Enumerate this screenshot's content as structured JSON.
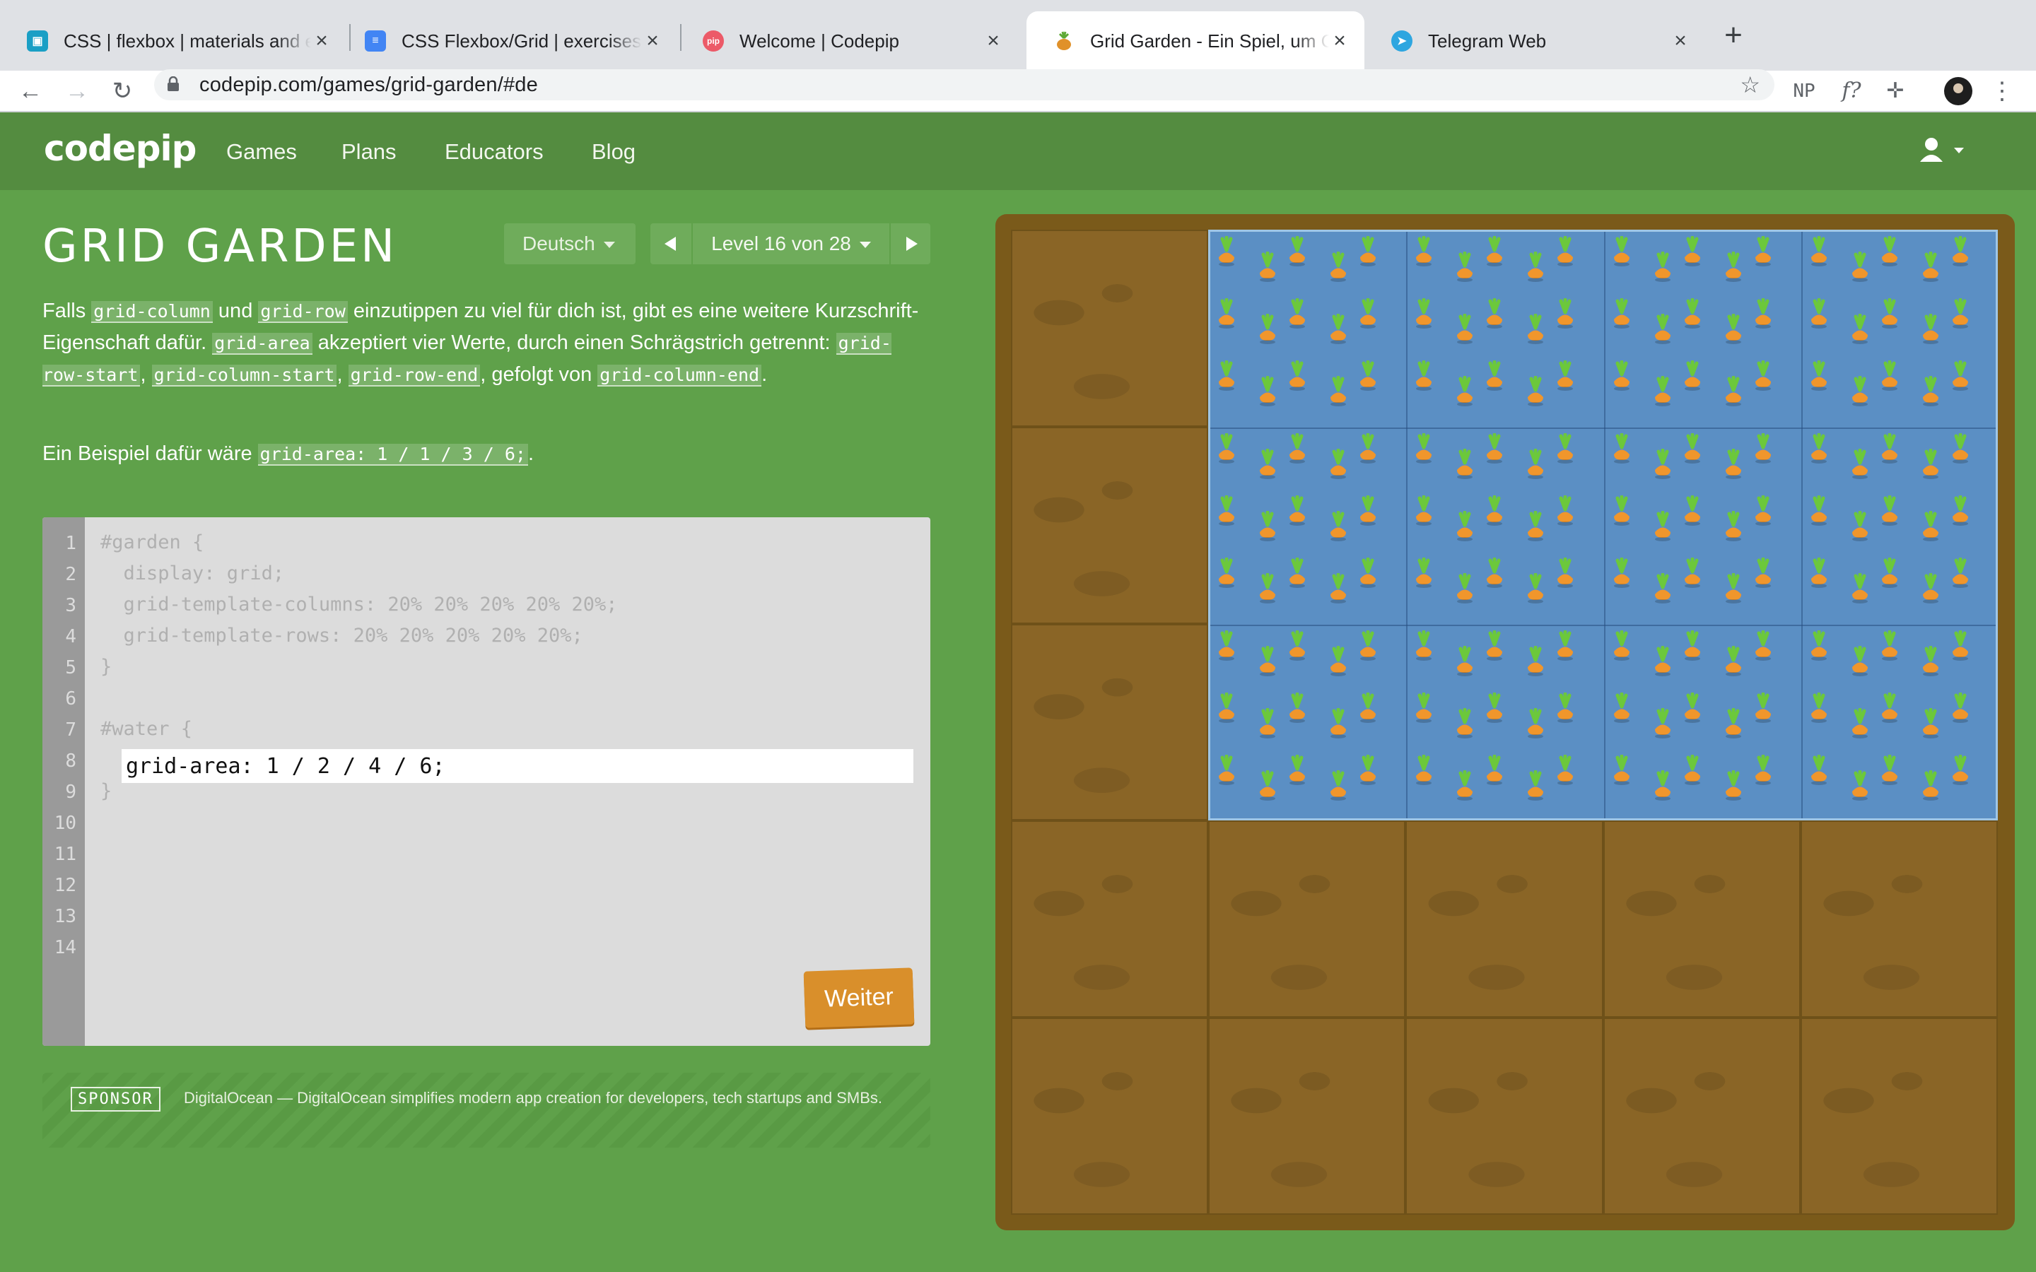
{
  "browser": {
    "tabs": [
      {
        "title": "CSS | flexbox | materials and exercises",
        "favicon": "classroom-icon",
        "color": "#1a9fc5",
        "active": false
      },
      {
        "title": "CSS Flexbox/Grid | exercises | Google Docs",
        "favicon": "docs-icon",
        "color": "#4285f4",
        "active": false
      },
      {
        "title": "Welcome | Codepip",
        "favicon": "codepip-icon",
        "color": "#ec5a68",
        "active": false
      },
      {
        "title": "Grid Garden - Ein Spiel, um CSS Grid zu lernen",
        "favicon": "carrot-icon",
        "color": "#d98f2b",
        "active": true
      },
      {
        "title": "Telegram Web",
        "favicon": "telegram-icon",
        "color": "#2ea6e0",
        "active": false
      }
    ],
    "url": "codepip.com/games/grid-garden/#de",
    "extensions": [
      "NP",
      "f?",
      "✛"
    ]
  },
  "site": {
    "logo": "codepip",
    "nav": [
      "Games",
      "Plans",
      "Educators",
      "Blog"
    ]
  },
  "game": {
    "title": "GRID GARDEN",
    "language": "Deutsch",
    "level_label": "Level 16 von 28",
    "level_current": 16,
    "level_total": 28,
    "instructions": {
      "t1": "Falls ",
      "c1": "grid-column",
      "t2": " und ",
      "c2": "grid-row",
      "t3": " einzutippen zu viel für dich ist, gibt es eine weitere Kurzschrift-Eigenschaft dafür. ",
      "c3": "grid-area",
      "t4": " akzeptiert vier Werte, durch einen Schrägstrich getrennt: ",
      "c4": "grid-row-start",
      "t5": ", ",
      "c5": "grid-column-start",
      "t6": ", ",
      "c6": "grid-row-end",
      "t7": ", gefolgt von ",
      "c7": "grid-column-end",
      "t8": "."
    },
    "example": {
      "prefix": "Ein Beispiel dafür wäre ",
      "code": "grid-area: 1 / 1 / 3 / 6;",
      "suffix": "."
    },
    "editor": {
      "line_numbers": [
        "1",
        "2",
        "3",
        "4",
        "5",
        "6",
        "7",
        "8",
        "9",
        "10",
        "11",
        "12",
        "13",
        "14"
      ],
      "code_lines": [
        "#garden {",
        "  display: grid;",
        "  grid-template-columns: 20% 20% 20% 20% 20%;",
        "  grid-template-rows: 20% 20% 20% 20% 20%;",
        "}",
        "",
        "#water {",
        "",
        "}"
      ],
      "input_value": "grid-area: 1 / 2 / 4 / 6;",
      "next_label": "Weiter"
    },
    "sponsor": {
      "tag": "SPONSOR",
      "text": "DigitalOcean — DigitalOcean simplifies modern app creation for developers, tech startups and SMBs."
    },
    "garden": {
      "grid_size": 5,
      "water_area": {
        "row_start": 1,
        "column_start": 2,
        "row_end": 4,
        "column_end": 6
      }
    }
  },
  "colors": {
    "page_bg": "#5fa14a",
    "nav_bg": "#548c40",
    "soil": "#8a6526",
    "water": "#5b8fc4",
    "button": "#d98f2b"
  }
}
